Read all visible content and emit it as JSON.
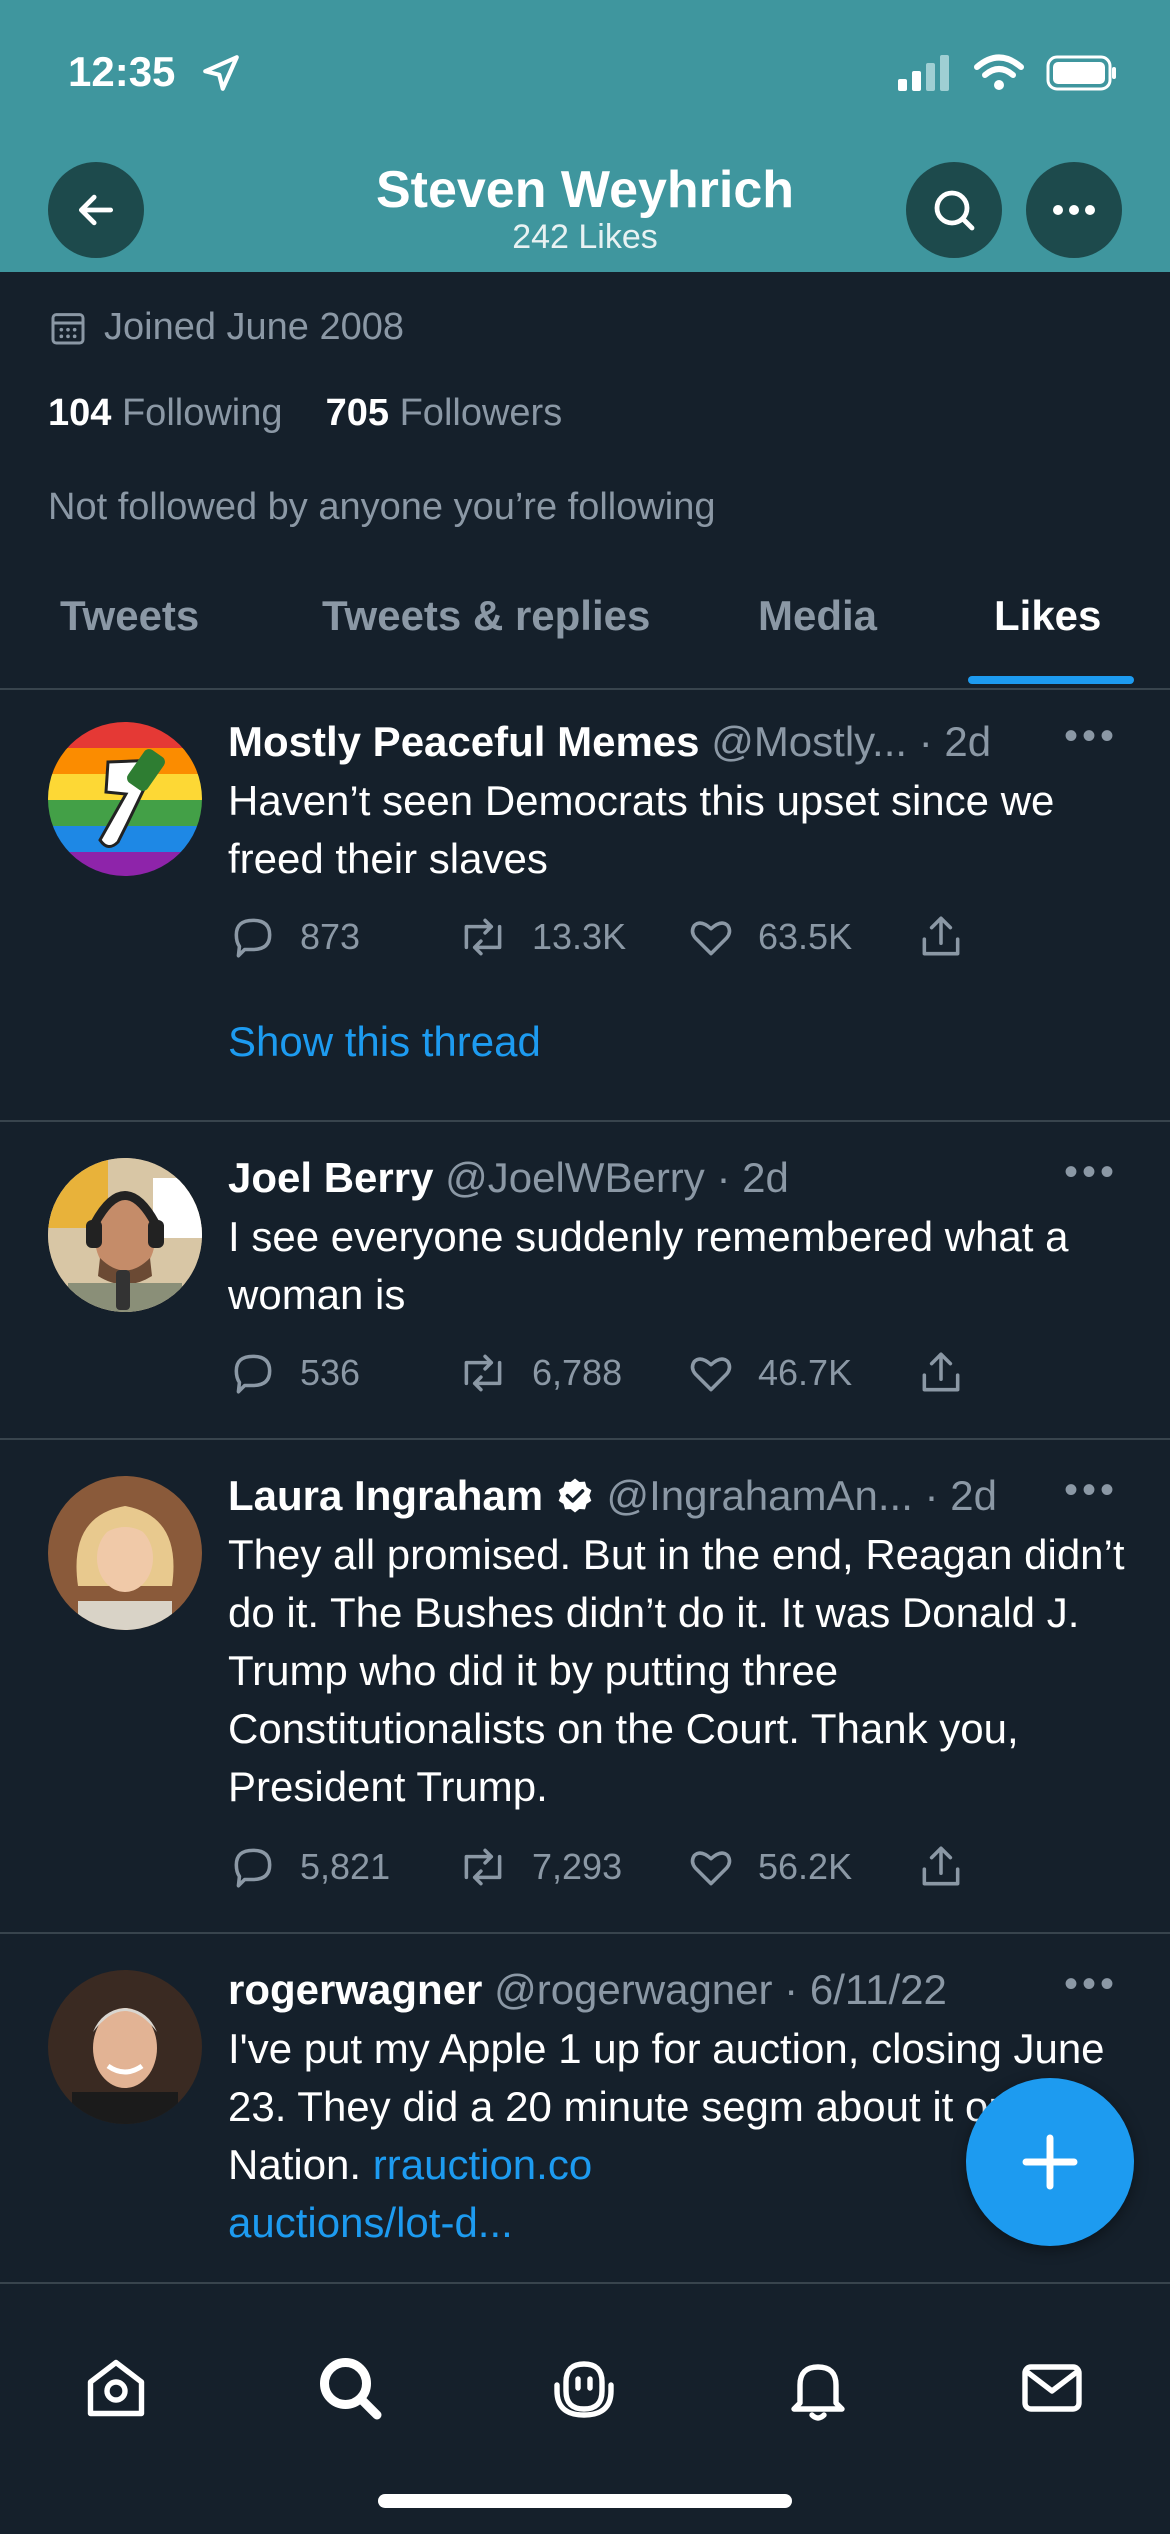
{
  "status_bar": {
    "time": "12:35"
  },
  "header": {
    "title": "Steven Weyhrich",
    "subtitle": "242 Likes"
  },
  "profile": {
    "joined": "Joined June 2008",
    "following_count": "104",
    "following_label": "Following",
    "followers_count": "705",
    "followers_label": "Followers",
    "not_followed": "Not followed by anyone you’re following"
  },
  "tabs": [
    {
      "label": "Tweets"
    },
    {
      "label": "Tweets & replies"
    },
    {
      "label": "Media"
    },
    {
      "label": "Likes",
      "active": true
    }
  ],
  "tweets": [
    {
      "name": "Mostly Peaceful Memes",
      "handle": "@Mostly... · 2d",
      "text": "Haven’t seen Democrats this upset since we freed their slaves",
      "replies": "873",
      "retweets": "13.3K",
      "likes": "63.5K",
      "show_thread": "Show this thread"
    },
    {
      "name": "Joel Berry",
      "handle": "@JoelWBerry · 2d",
      "text": "I see everyone suddenly remembered what a woman is",
      "replies": "536",
      "retweets": "6,788",
      "likes": "46.7K"
    },
    {
      "name": "Laura Ingraham",
      "handle": "@IngrahamAn... · 2d",
      "text": "They all promised.  But in the end, Reagan didn’t do it.  The Bushes didn’t do it.  It was Donald J. Trump who did it by putting three Constitutionalists on the Court. Thank you, President Trump.",
      "replies": "5,821",
      "retweets": "7,293",
      "likes": "56.2K"
    },
    {
      "name": "rogerwagner",
      "handle": "@rogerwagner · 6/11/22",
      "text": "I've put my Apple 1 up for auction, closing June 23.  They did a 20 minute segm",
      "text_line3": "about it on Fox Nation.",
      "link_a": "rrauction.co",
      "link_b": "auctions/lot-d..."
    }
  ],
  "colors": {
    "header_bg": "#3f969e",
    "page_bg": "#15202b",
    "accent": "#1d9bf0",
    "muted": "#8b98a5"
  }
}
